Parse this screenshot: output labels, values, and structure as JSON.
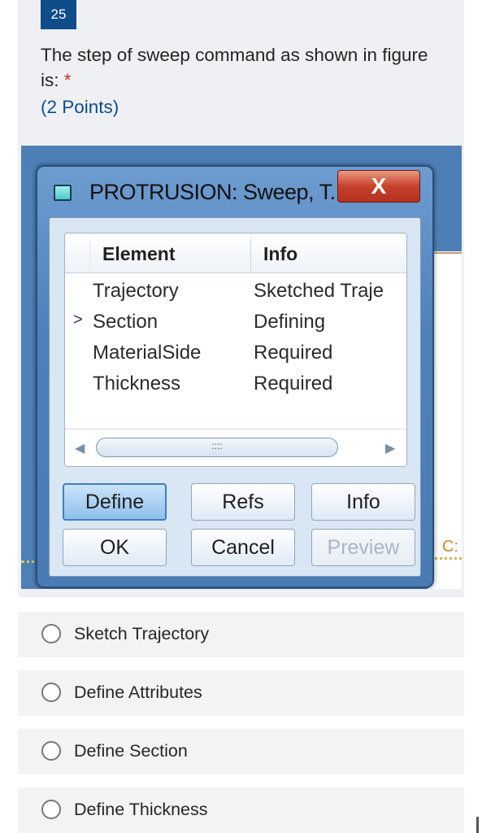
{
  "question": {
    "number": "25",
    "text": "The step of sweep command as shown in figure is:",
    "required_mark": "*",
    "points": "(2 Points)"
  },
  "figure": {
    "dialog_title": "PROTRUSION: Sweep, T...",
    "close_glyph": "X",
    "columns": [
      "Element",
      "Info"
    ],
    "rows": [
      {
        "marker": "",
        "element": "Trajectory",
        "info": "Sketched Traje"
      },
      {
        "marker": ">",
        "element": "Section",
        "info": "Defining"
      },
      {
        "marker": "",
        "element": "MaterialSide",
        "info": "Required"
      },
      {
        "marker": "",
        "element": "Thickness",
        "info": "Required"
      }
    ],
    "scroll_thumb_grip": "::::",
    "buttons": {
      "define": "Define",
      "refs": "Refs",
      "info": "Info",
      "ok": "OK",
      "cancel": "Cancel",
      "preview": "Preview"
    },
    "background_fragment": "C:"
  },
  "options": [
    "Sketch Trajectory",
    "Define Attributes",
    "Define Section",
    "Define Thickness"
  ],
  "colors": {
    "accent": "#0f4c8a",
    "required": "#c0392b",
    "dialog_frame": "#4e80ba",
    "close_button": "#c8412c"
  }
}
